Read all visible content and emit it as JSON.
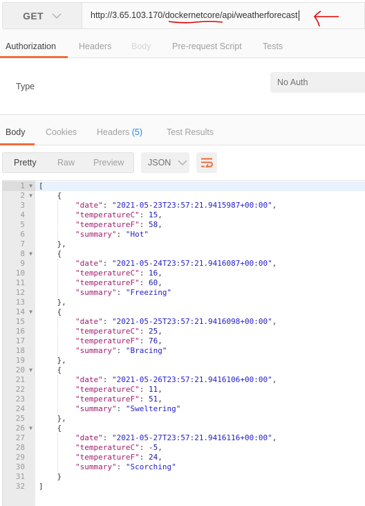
{
  "request": {
    "method": "GET",
    "url": "http://3.65.103.170/dockernetcore/api/weatherforecast"
  },
  "request_tabs": [
    {
      "label": "Authorization",
      "state": "active"
    },
    {
      "label": "Headers",
      "state": "normal"
    },
    {
      "label": "Body",
      "state": "disabled"
    },
    {
      "label": "Pre-request Script",
      "state": "normal"
    },
    {
      "label": "Tests",
      "state": "normal"
    }
  ],
  "auth": {
    "type_label": "Type",
    "type_value": "No Auth"
  },
  "response_tabs": [
    {
      "label": "Body",
      "state": "active"
    },
    {
      "label": "Cookies",
      "state": "normal"
    },
    {
      "label": "Headers",
      "count": "(5)",
      "state": "normal"
    },
    {
      "label": "Test Results",
      "state": "normal"
    }
  ],
  "view_modes": [
    "Pretty",
    "Raw",
    "Preview"
  ],
  "active_view_mode": "Pretty",
  "format": "JSON",
  "icons": {
    "method_dropdown": "chevron-down-icon",
    "format_dropdown": "chevron-down-icon",
    "wrap": "wrap-lines-icon",
    "fold": "fold-arrow-icon"
  },
  "colors": {
    "accent": "#f26b3a",
    "json_key": "#a31b6e",
    "json_string": "#2520c8",
    "json_number": "#1a1aa6",
    "headers_count": "#1e88e5",
    "annotation": "#e00000"
  },
  "response_body": [
    {
      "date": "2021-05-23T23:57:21.9415987+00:00",
      "temperatureC": 15,
      "temperatureF": 58,
      "summary": "Hot"
    },
    {
      "date": "2021-05-24T23:57:21.9416087+00:00",
      "temperatureC": 16,
      "temperatureF": 60,
      "summary": "Freezing"
    },
    {
      "date": "2021-05-25T23:57:21.9416098+00:00",
      "temperatureC": 25,
      "temperatureF": 76,
      "summary": "Bracing"
    },
    {
      "date": "2021-05-26T23:57:21.9416106+00:00",
      "temperatureC": 11,
      "temperatureF": 51,
      "summary": "Sweltering"
    },
    {
      "date": "2021-05-27T23:57:21.9416116+00:00",
      "temperatureC": -5,
      "temperatureF": 24,
      "summary": "Scorching"
    }
  ],
  "line_count": 32
}
